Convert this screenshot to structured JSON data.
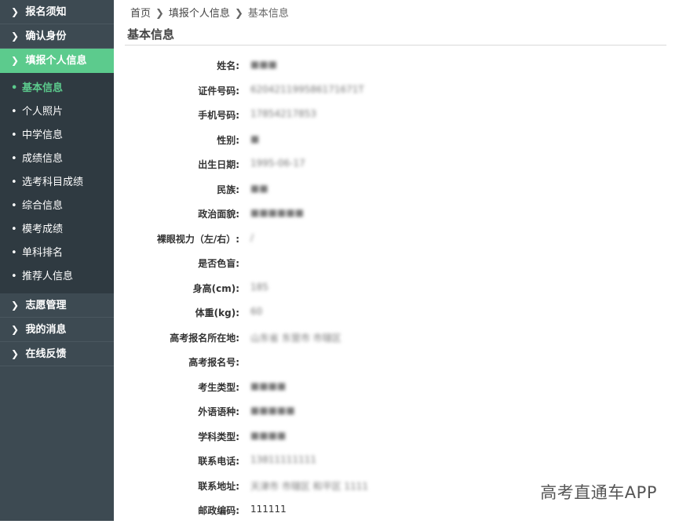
{
  "sidebar": {
    "top_items": [
      {
        "label": "报名须知"
      },
      {
        "label": "确认身份"
      },
      {
        "label": "填报个人信息"
      }
    ],
    "sub_items": [
      {
        "label": "基本信息"
      },
      {
        "label": "个人照片"
      },
      {
        "label": "中学信息"
      },
      {
        "label": "成绩信息"
      },
      {
        "label": "选考科目成绩"
      },
      {
        "label": "综合信息"
      },
      {
        "label": "模考成绩"
      },
      {
        "label": "单科排名"
      },
      {
        "label": "推荐人信息"
      }
    ],
    "bottom_items": [
      {
        "label": "志愿管理"
      },
      {
        "label": "我的消息"
      },
      {
        "label": "在线反馈"
      }
    ]
  },
  "breadcrumb": {
    "home": "首页",
    "level2": "填报个人信息",
    "level3": "基本信息"
  },
  "page_title": "基本信息",
  "fields": [
    {
      "label": "姓名:",
      "value": "■■■"
    },
    {
      "label": "证件号码:",
      "value": "620421199586171671T"
    },
    {
      "label": "手机号码:",
      "value": "17854217853"
    },
    {
      "label": "性别:",
      "value": "■"
    },
    {
      "label": "出生日期:",
      "value": "1995-06-17"
    },
    {
      "label": "民族:",
      "value": "■■"
    },
    {
      "label": "政治面貌:",
      "value": "■■■■■■"
    },
    {
      "label": "裸眼视力（左/右）:",
      "value": "/"
    },
    {
      "label": "是否色盲:",
      "value": ""
    },
    {
      "label": "身高(cm):",
      "value": "185"
    },
    {
      "label": "体重(kg):",
      "value": "60"
    },
    {
      "label": "高考报名所在地:",
      "value": "山东省 东营市 市辖区"
    },
    {
      "label": "高考报名号:",
      "value": ""
    },
    {
      "label": "考生类型:",
      "value": "■■■■"
    },
    {
      "label": "外语语种:",
      "value": "■■■■■"
    },
    {
      "label": "学科类型:",
      "value": "■■■■"
    },
    {
      "label": "联系电话:",
      "value": "13811111111"
    },
    {
      "label": "联系地址:",
      "value": "天津市 市辖区 和平区 1111"
    },
    {
      "label": "邮政编码:",
      "value": "111111"
    }
  ],
  "watermark": "高考直通车APP",
  "colors": {
    "sidebar_bg": "#3d4a52",
    "submenu_bg": "#2f3a41",
    "accent_green": "#5ccb8d"
  },
  "icons": {
    "nav_arrow": "chevron-right-icon",
    "sub_bullet": "bullet-icon"
  }
}
